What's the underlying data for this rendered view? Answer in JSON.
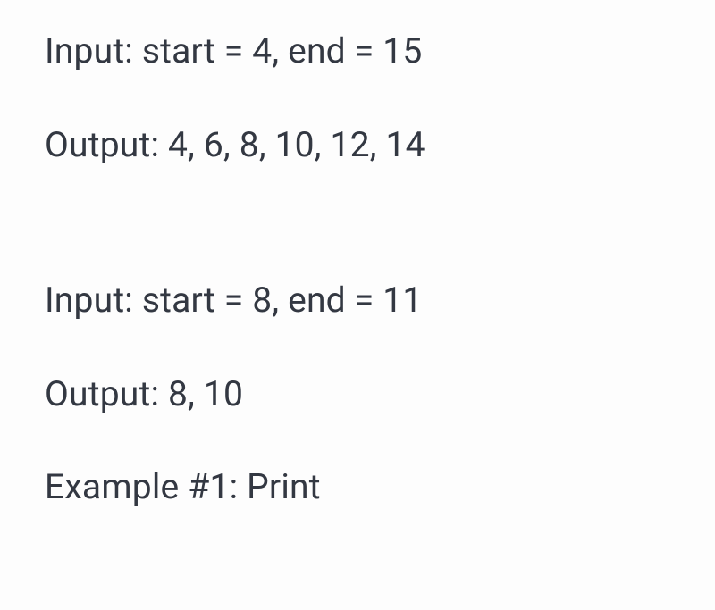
{
  "lines": {
    "input1": "Input: start = 4, end = 15",
    "output1": "Output: 4, 6, 8, 10, 12, 14",
    "input2": "Input: start = 8, end = 11",
    "output2": "Output: 8, 10",
    "example1": "Example #1: Print"
  }
}
